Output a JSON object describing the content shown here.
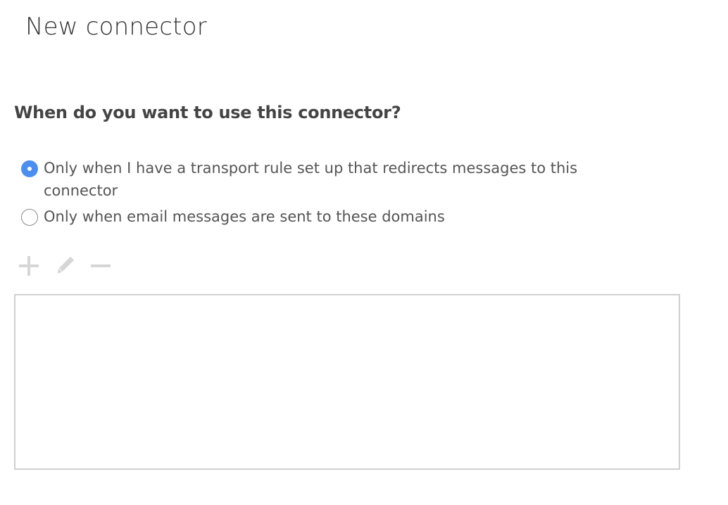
{
  "page": {
    "title": "New connector",
    "question": "When do you want to use this connector?"
  },
  "options": [
    {
      "label": "Only when I have a transport rule set up that redirects messages to this connector",
      "selected": true
    },
    {
      "label": "Only when email messages are sent to these domains",
      "selected": false
    }
  ],
  "toolbar": {
    "add_icon": "plus-icon",
    "edit_icon": "pencil-icon",
    "remove_icon": "minus-icon",
    "disabled": true
  },
  "domain_list": {
    "items": []
  },
  "colors": {
    "accent": "#4a8ef0",
    "disabled_icon": "#d6d6d6",
    "border": "#d0d0d0"
  }
}
